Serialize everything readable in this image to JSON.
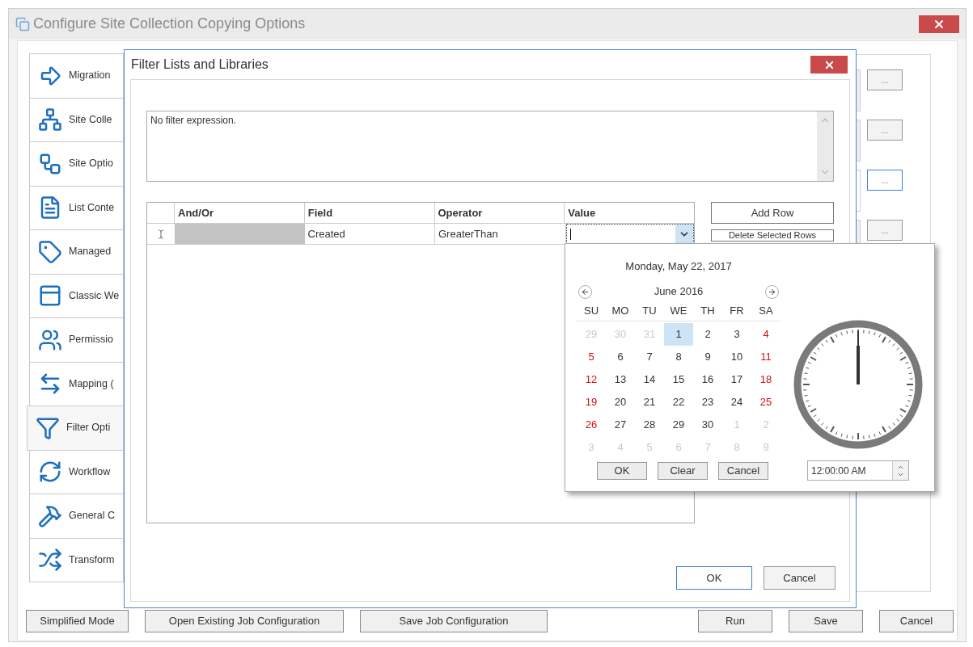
{
  "window": {
    "title": "Configure Site Collection Copying Options"
  },
  "nav": [
    {
      "label": "Migration",
      "selected": false
    },
    {
      "label": "Site Colle",
      "selected": false
    },
    {
      "label": "Site Optio",
      "selected": false
    },
    {
      "label": "List Conte",
      "selected": false
    },
    {
      "label": "Managed",
      "selected": false
    },
    {
      "label": "Classic We",
      "selected": false
    },
    {
      "label": "Permissio",
      "selected": false
    },
    {
      "label": "Mapping (",
      "selected": false
    },
    {
      "label": "Filter Opti",
      "selected": true
    },
    {
      "label": "Workflow",
      "selected": false
    },
    {
      "label": "General C",
      "selected": false
    },
    {
      "label": "Transform",
      "selected": false
    }
  ],
  "side_buttons": [
    {
      "label": "...",
      "selected": false
    },
    {
      "label": "...",
      "selected": false
    },
    {
      "label": "...",
      "selected": true
    },
    {
      "label": "...",
      "selected": false
    }
  ],
  "footer_buttons": [
    "Simplified Mode",
    "Open Existing Job Configuration",
    "Save Job Configuration"
  ],
  "footer_actions": [
    "Run",
    "Save",
    "Cancel"
  ],
  "dialog": {
    "title": "Filter Lists and Libraries",
    "expression": "No filter expression.",
    "columns": [
      "And/Or",
      "Field",
      "Operator",
      "Value"
    ],
    "rows": [
      {
        "and_or": "",
        "field": "Created",
        "operator": "GreaterThan",
        "value": ""
      }
    ],
    "buttons": [
      "Add Row",
      "Delete Selected Rows"
    ],
    "ok": "OK",
    "cancel": "Cancel"
  },
  "picker": {
    "today": "Monday, May 22, 2017",
    "month": "June 2016",
    "weekdays": [
      "SU",
      "MO",
      "TU",
      "WE",
      "TH",
      "FR",
      "SA"
    ],
    "weeks": [
      [
        {
          "text": "29",
          "kind": "other",
          "selected": false
        },
        {
          "text": "30",
          "kind": "other",
          "selected": false
        },
        {
          "text": "31",
          "kind": "other",
          "selected": false
        },
        {
          "text": "1",
          "kind": "day",
          "selected": true
        },
        {
          "text": "2",
          "kind": "day",
          "selected": false
        },
        {
          "text": "3",
          "kind": "day",
          "selected": false
        },
        {
          "text": "4",
          "kind": "weekend",
          "selected": false
        }
      ],
      [
        {
          "text": "5",
          "kind": "weekend",
          "selected": false
        },
        {
          "text": "6",
          "kind": "day",
          "selected": false
        },
        {
          "text": "7",
          "kind": "day",
          "selected": false
        },
        {
          "text": "8",
          "kind": "day",
          "selected": false
        },
        {
          "text": "9",
          "kind": "day",
          "selected": false
        },
        {
          "text": "10",
          "kind": "day",
          "selected": false
        },
        {
          "text": "11",
          "kind": "weekend",
          "selected": false
        }
      ],
      [
        {
          "text": "12",
          "kind": "weekend",
          "selected": false
        },
        {
          "text": "13",
          "kind": "day",
          "selected": false
        },
        {
          "text": "14",
          "kind": "day",
          "selected": false
        },
        {
          "text": "15",
          "kind": "day",
          "selected": false
        },
        {
          "text": "16",
          "kind": "day",
          "selected": false
        },
        {
          "text": "17",
          "kind": "day",
          "selected": false
        },
        {
          "text": "18",
          "kind": "weekend",
          "selected": false
        }
      ],
      [
        {
          "text": "19",
          "kind": "weekend",
          "selected": false
        },
        {
          "text": "20",
          "kind": "day",
          "selected": false
        },
        {
          "text": "21",
          "kind": "day",
          "selected": false
        },
        {
          "text": "22",
          "kind": "day",
          "selected": false
        },
        {
          "text": "23",
          "kind": "day",
          "selected": false
        },
        {
          "text": "24",
          "kind": "day",
          "selected": false
        },
        {
          "text": "25",
          "kind": "weekend",
          "selected": false
        }
      ],
      [
        {
          "text": "26",
          "kind": "weekend",
          "selected": false
        },
        {
          "text": "27",
          "kind": "day",
          "selected": false
        },
        {
          "text": "28",
          "kind": "day",
          "selected": false
        },
        {
          "text": "29",
          "kind": "day",
          "selected": false
        },
        {
          "text": "30",
          "kind": "day",
          "selected": false
        },
        {
          "text": "1",
          "kind": "other",
          "selected": false
        },
        {
          "text": "2",
          "kind": "other",
          "selected": false
        }
      ],
      [
        {
          "text": "3",
          "kind": "other",
          "selected": false
        },
        {
          "text": "4",
          "kind": "other",
          "selected": false
        },
        {
          "text": "5",
          "kind": "other",
          "selected": false
        },
        {
          "text": "6",
          "kind": "other",
          "selected": false
        },
        {
          "text": "7",
          "kind": "other",
          "selected": false
        },
        {
          "text": "8",
          "kind": "other",
          "selected": false
        },
        {
          "text": "9",
          "kind": "other",
          "selected": false
        }
      ]
    ],
    "buttons": [
      "OK",
      "Clear",
      "Cancel"
    ],
    "time": "12:00:00 AM"
  }
}
